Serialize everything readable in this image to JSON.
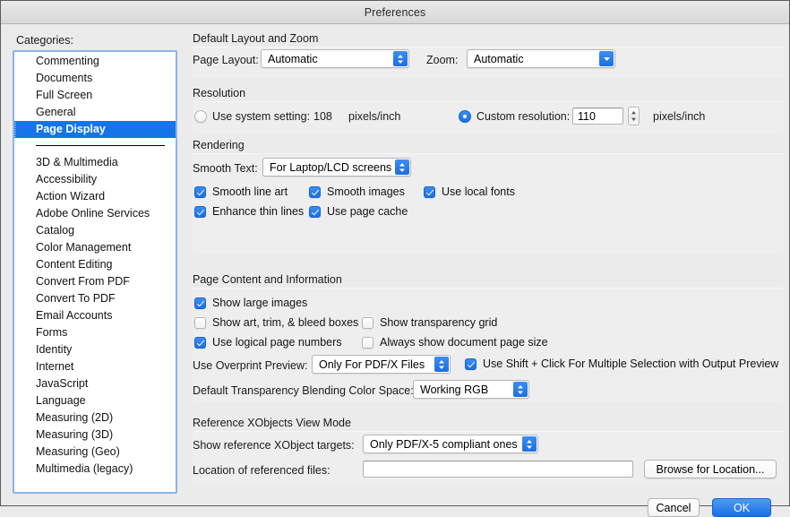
{
  "window": {
    "title": "Preferences"
  },
  "sidebar": {
    "label": "Categories:",
    "top_items": [
      {
        "label": "Commenting",
        "selected": false
      },
      {
        "label": "Documents",
        "selected": false
      },
      {
        "label": "Full Screen",
        "selected": false
      },
      {
        "label": "General",
        "selected": false
      },
      {
        "label": "Page Display",
        "selected": true
      }
    ],
    "bottom_items": [
      {
        "label": "3D & Multimedia"
      },
      {
        "label": "Accessibility"
      },
      {
        "label": "Action Wizard"
      },
      {
        "label": "Adobe Online Services"
      },
      {
        "label": "Catalog"
      },
      {
        "label": "Color Management"
      },
      {
        "label": "Content Editing"
      },
      {
        "label": "Convert From PDF"
      },
      {
        "label": "Convert To PDF"
      },
      {
        "label": "Email Accounts"
      },
      {
        "label": "Forms"
      },
      {
        "label": "Identity"
      },
      {
        "label": "Internet"
      },
      {
        "label": "JavaScript"
      },
      {
        "label": "Language"
      },
      {
        "label": "Measuring (2D)"
      },
      {
        "label": "Measuring (3D)"
      },
      {
        "label": "Measuring (Geo)"
      },
      {
        "label": "Multimedia (legacy)"
      }
    ]
  },
  "sections": {
    "layout_zoom": {
      "title": "Default Layout and Zoom",
      "page_layout_label": "Page Layout:",
      "page_layout_value": "Automatic",
      "zoom_label": "Zoom:",
      "zoom_value": "Automatic"
    },
    "resolution": {
      "title": "Resolution",
      "system_label": "Use system setting:",
      "system_value": "108",
      "system_units": "pixels/inch",
      "system_selected": false,
      "custom_label": "Custom resolution:",
      "custom_value": "110",
      "custom_units": "pixels/inch",
      "custom_selected": true
    },
    "rendering": {
      "title": "Rendering",
      "smooth_text_label": "Smooth Text:",
      "smooth_text_value": "For Laptop/LCD screens",
      "checkboxes": [
        {
          "label": "Smooth line art",
          "checked": true
        },
        {
          "label": "Smooth images",
          "checked": true
        },
        {
          "label": "Use local fonts",
          "checked": true
        },
        {
          "label": "Enhance thin lines",
          "checked": true
        },
        {
          "label": "Use page cache",
          "checked": true
        }
      ]
    },
    "page_content": {
      "title": "Page Content and Information",
      "checkboxes": [
        {
          "label": "Show large images",
          "checked": true
        },
        {
          "label": "Show art, trim, & bleed boxes",
          "checked": false
        },
        {
          "label": "Show transparency grid",
          "checked": false
        },
        {
          "label": "Use logical page numbers",
          "checked": true
        },
        {
          "label": "Always show document page size",
          "checked": false
        },
        {
          "label": "Use Shift + Click For Multiple Selection with Output Preview",
          "checked": true
        }
      ],
      "overprint_label": "Use Overprint Preview:",
      "overprint_value": "Only For PDF/X Files",
      "blending_label": "Default Transparency Blending Color Space:",
      "blending_value": "Working RGB"
    },
    "reference_xobjects": {
      "title": "Reference XObjects View Mode",
      "targets_label": "Show reference XObject targets:",
      "targets_value": "Only PDF/X-5 compliant ones",
      "location_label": "Location of referenced files:",
      "location_value": "",
      "location_placeholder": "",
      "browse_label": "Browse for Location..."
    }
  },
  "footer": {
    "cancel_label": "Cancel",
    "ok_label": "OK"
  },
  "colors": {
    "accent": "#1474e8",
    "selection": "#1474e8",
    "dialog_bg": "#ebebeb",
    "group_bg": "#eeeeee"
  }
}
